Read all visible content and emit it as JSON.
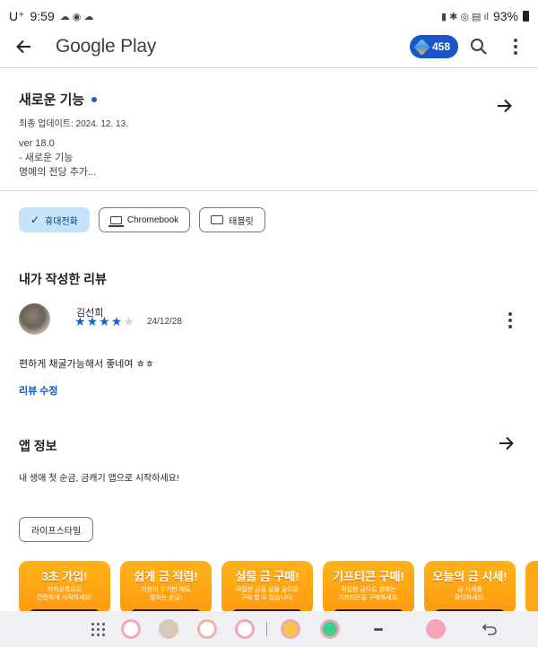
{
  "status_bar": {
    "carrier": "U⁺",
    "time": "9:59",
    "battery": "93%"
  },
  "app_bar": {
    "title": "Google Play",
    "points": "458"
  },
  "whats_new": {
    "title": "새로운 기능",
    "last_updated": "최종 업데이트: 2024. 12. 13.",
    "notes": [
      "ver 18.0",
      "- 새로운 기능",
      "명예의 전당 추가..."
    ]
  },
  "device_chips": [
    {
      "label": "휴대전화",
      "selected": true
    },
    {
      "label": "Chromebook",
      "selected": false
    },
    {
      "label": "태블릿",
      "selected": false
    }
  ],
  "my_review": {
    "heading": "내가 작성한 리뷰",
    "author": "김선희",
    "rating": 4,
    "max_rating": 5,
    "date": "24/12/28",
    "text": "편하게 채굴가능해서 좋네여 ㅎㅎ",
    "edit_label": "리뷰 수정"
  },
  "app_info": {
    "heading": "앱 정보",
    "description": "내 생애 첫 순금, 금캐기 앱으로 시작하세요!",
    "category": "라이프스타일"
  },
  "screenshots": [
    {
      "title": "3초 가입!",
      "subtitle": [
        "카카오톡으로",
        "간편하게 시작하세요!"
      ]
    },
    {
      "title": "쉽게 금 적립!",
      "subtitle": [
        "기한이 두기만 해도",
        "쌓이는 순금!"
      ]
    },
    {
      "title": "실물 금 구매!",
      "subtitle": [
        "적립한 금을 실물 금으로",
        "구매 할 수 있습니다."
      ]
    },
    {
      "title": "기프티콘 구매!",
      "subtitle": [
        "적립한 금으로 원하는",
        "기프티콘을 구매하세요."
      ]
    },
    {
      "title": "오늘의 금 시세!",
      "subtitle": [
        "금 시세를",
        "확인하세요."
      ]
    }
  ],
  "colors": {
    "accent": "#0b57d0",
    "points_pill": "#1a56c9",
    "chip_selected": "#c6e3fc",
    "banner": "#ffa91a"
  }
}
